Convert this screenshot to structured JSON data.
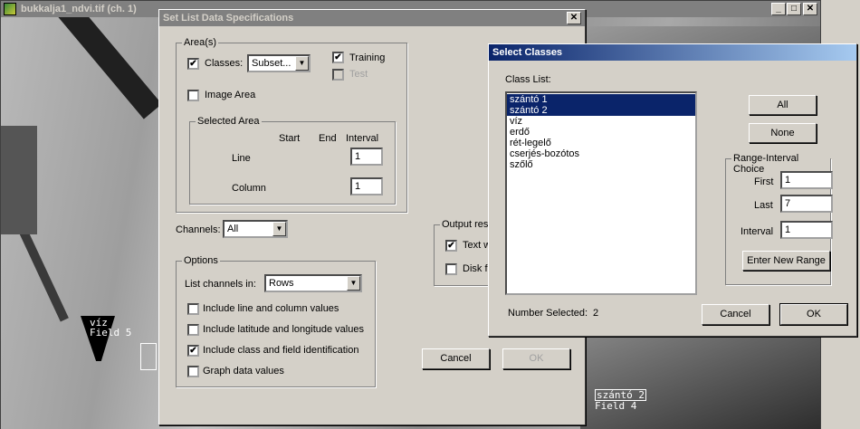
{
  "image_window": {
    "title": "bukkalja1_ndvi.tif (ch. 1)",
    "overlays": [
      {
        "class": "víz",
        "field": "Field 5"
      },
      {
        "class": "szántó 2",
        "field": "Field 4"
      }
    ]
  },
  "list_spec": {
    "title": "Set List Data Specifications",
    "areas": {
      "legend": "Area(s)",
      "classes_label": "Classes:",
      "classes_checked": true,
      "classes_combo": "Subset...",
      "training_label": "Training",
      "training_checked": true,
      "test_label": "Test",
      "test_checked": false,
      "image_area_label": "Image Area",
      "image_area_checked": false,
      "selected_area": {
        "legend": "Selected Area",
        "col_start": "Start",
        "col_end": "End",
        "col_interval": "Interval",
        "line_label": "Line",
        "line_interval": "1",
        "column_label": "Column",
        "column_interval": "1"
      }
    },
    "channels_label": "Channels:",
    "channels_value": "All",
    "output": {
      "legend": "Output res",
      "text_label": "Text w",
      "text_checked": true,
      "disk_label": "Disk f",
      "disk_checked": false
    },
    "options": {
      "legend": "Options",
      "list_channels_label": "List channels in:",
      "list_channels_value": "Rows",
      "items": [
        {
          "label": "Include line and column values",
          "checked": false
        },
        {
          "label": "Include latitude and longitude values",
          "checked": false
        },
        {
          "label": "Include class and field identification",
          "checked": true
        },
        {
          "label": "Graph data values",
          "checked": false
        }
      ]
    },
    "cancel": "Cancel",
    "ok": "OK"
  },
  "select_classes": {
    "title": "Select Classes",
    "class_list_label": "Class List:",
    "classes": [
      {
        "name": "szántó 1",
        "selected": true
      },
      {
        "name": "szántó 2",
        "selected": true
      },
      {
        "name": "víz",
        "selected": false
      },
      {
        "name": "erdő",
        "selected": false
      },
      {
        "name": "rét-legelő",
        "selected": false
      },
      {
        "name": "cserjés-bozótos",
        "selected": false
      },
      {
        "name": "szőlő",
        "selected": false
      }
    ],
    "all_label": "All",
    "none_label": "None",
    "range": {
      "legend": "Range-Interval Choice",
      "first_label": "First",
      "first_value": "1",
      "last_label": "Last",
      "last_value": "7",
      "interval_label": "Interval",
      "interval_value": "1",
      "enter_label": "Enter New Range"
    },
    "number_selected_label": "Number Selected:",
    "number_selected_value": "2",
    "cancel": "Cancel",
    "ok": "OK"
  },
  "colors": {
    "titlebar_active": "#0a246a",
    "titlebar_inactive": "#808080",
    "face": "#d4d0c8"
  }
}
